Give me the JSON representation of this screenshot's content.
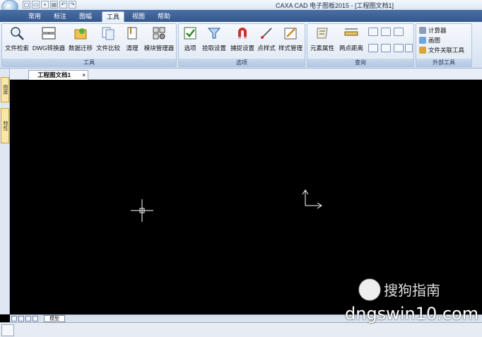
{
  "app": {
    "window_title": "CAXA CAD 电子图板2015 - [工程图文档1]"
  },
  "tabs": [
    {
      "label": "常用",
      "active": false
    },
    {
      "label": "标注",
      "active": false
    },
    {
      "label": "图幅",
      "active": false
    },
    {
      "label": "工具",
      "active": true
    },
    {
      "label": "视图",
      "active": false
    },
    {
      "label": "帮助",
      "active": false
    }
  ],
  "ribbon": {
    "tools": {
      "label": "工具",
      "buttons": [
        "文件检索",
        "DWG转换器",
        "数据迁移",
        "文件比较",
        "清理",
        "模块管理器"
      ]
    },
    "options": {
      "label": "选项",
      "buttons": [
        "选项",
        "拾取设置",
        "捕捉设置",
        "点样式",
        "样式管理"
      ]
    },
    "query": {
      "label": "查询",
      "buttons": [
        "元素属性",
        "两点距离"
      ]
    },
    "external": {
      "label": "外部工具",
      "items": [
        "计算器",
        "画图",
        "文件关联工具"
      ]
    }
  },
  "side_tabs": [
    "图库",
    "特性"
  ],
  "document": {
    "tab_label": "工程图文档1",
    "close_glyph": "×",
    "layout_tab": "模型"
  },
  "watermark": {
    "brand": "搜狗指南",
    "site": "dngswin10.com"
  },
  "colors": {
    "canvas_background": "#000000",
    "ribbon_tab_bar": "#3d5f94",
    "crosshair": "#ffffff"
  }
}
